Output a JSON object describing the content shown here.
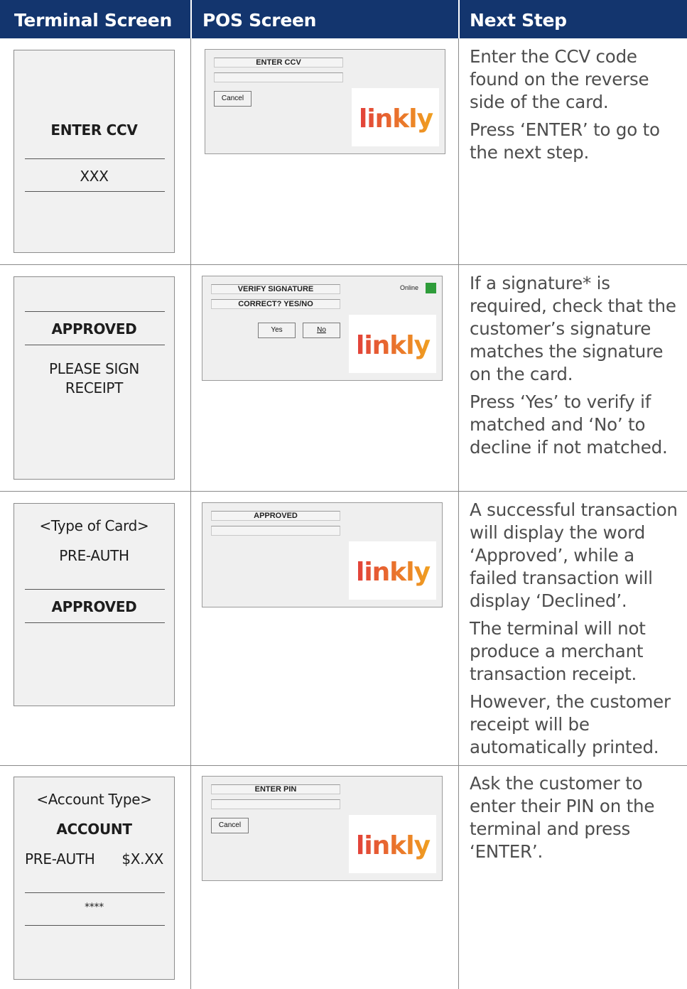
{
  "header": {
    "col1": "Terminal Screen",
    "col2": "POS Screen",
    "col3": "Next Step"
  },
  "rows": [
    {
      "terminal": {
        "line1": "ENTER CCV",
        "line2": "XXX"
      },
      "pos": {
        "field1": "ENTER CCV",
        "field2": "",
        "cancel": "Cancel",
        "logo": "linkly"
      },
      "step": [
        "Enter the CCV code found on the reverse side of the card.",
        "Press ‘ENTER’ to go to the next step."
      ]
    },
    {
      "terminal": {
        "line1": "APPROVED",
        "line2": "PLEASE SIGN",
        "line3": "RECEIPT"
      },
      "pos": {
        "field1": "VERIFY SIGNATURE",
        "field2": "CORRECT?  YES/NO",
        "yes": "Yes",
        "no": "No",
        "online": "Online",
        "logo": "linkly"
      },
      "step": [
        "If a signature* is required, check that the customer’s signature matches the signature on the card.",
        "Press ‘Yes’ to verify if matched and ‘No’ to decline if not matched."
      ]
    },
    {
      "terminal": {
        "line1": "<Type of Card>",
        "line2": "PRE-AUTH",
        "line3": "APPROVED"
      },
      "pos": {
        "field1": "APPROVED",
        "field2": "",
        "logo": "linkly"
      },
      "step": [
        "A successful transaction will display the word ‘Approved’, while a failed transaction will display ‘Declined’.",
        "The terminal will not produce a merchant transaction receipt.",
        "However, the customer receipt will be automatically printed."
      ]
    },
    {
      "terminal": {
        "line1": "<Account Type>",
        "line2": "ACCOUNT",
        "line3a": "PRE-AUTH",
        "line3b": "$X.XX",
        "line4": "****"
      },
      "pos": {
        "field1": "ENTER PIN",
        "field2": "",
        "cancel": "Cancel",
        "logo": "linkly"
      },
      "step": [
        "Ask the customer to enter their PIN on the terminal and press ‘ENTER’."
      ]
    }
  ],
  "colors": {
    "header_bg": "#13356e",
    "led": "#2e9c3a",
    "logo_gradient": [
      "#e2403a",
      "#f0a020"
    ]
  }
}
